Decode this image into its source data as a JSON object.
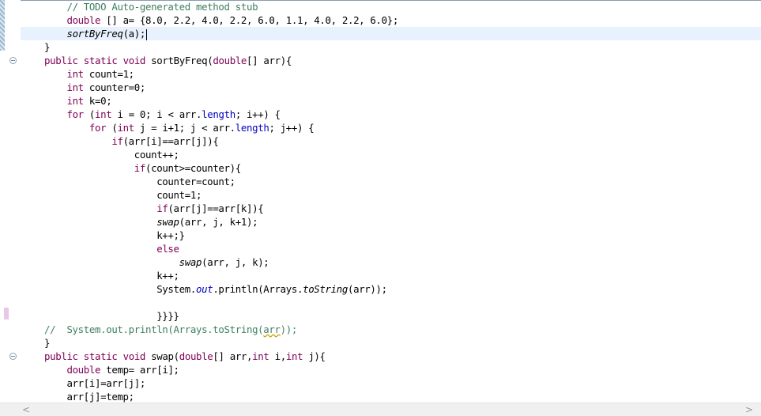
{
  "lines": [
    {
      "segs": [
        {
          "t": "    "
        },
        {
          "t": "// TODO Auto-generated method stub",
          "c": "cm"
        }
      ]
    },
    {
      "segs": [
        {
          "t": "    "
        },
        {
          "t": "double",
          "c": "kw"
        },
        {
          "t": " [] a= {8.0, 2.2, 4.0, 2.2, 6.0, 1.1, 4.0, 2.2, 6.0};"
        }
      ]
    },
    {
      "current": true,
      "cursor": true,
      "segs": [
        {
          "t": "    "
        },
        {
          "t": "sortByFreq",
          "c": "it"
        },
        {
          "t": "(a);"
        }
      ]
    },
    {
      "segs": [
        {
          "t": "}"
        }
      ]
    },
    {
      "fold": true,
      "segs": [
        {
          "t": "public",
          "c": "kw"
        },
        {
          "t": " "
        },
        {
          "t": "static",
          "c": "kw"
        },
        {
          "t": " "
        },
        {
          "t": "void",
          "c": "kw"
        },
        {
          "t": " sortByFreq("
        },
        {
          "t": "double",
          "c": "kw"
        },
        {
          "t": "[] arr){"
        }
      ]
    },
    {
      "segs": [
        {
          "t": "    "
        },
        {
          "t": "int",
          "c": "kw"
        },
        {
          "t": " count=1;"
        }
      ]
    },
    {
      "segs": [
        {
          "t": "    "
        },
        {
          "t": "int",
          "c": "kw"
        },
        {
          "t": " counter=0;"
        }
      ]
    },
    {
      "segs": [
        {
          "t": "    "
        },
        {
          "t": "int",
          "c": "kw"
        },
        {
          "t": " k=0;"
        }
      ]
    },
    {
      "segs": [
        {
          "t": "    "
        },
        {
          "t": "for",
          "c": "kw"
        },
        {
          "t": " ("
        },
        {
          "t": "int",
          "c": "kw"
        },
        {
          "t": " i = 0; i < arr."
        },
        {
          "t": "length",
          "c": "fld"
        },
        {
          "t": "; i++) {"
        }
      ]
    },
    {
      "segs": [
        {
          "t": "        "
        },
        {
          "t": "for",
          "c": "kw"
        },
        {
          "t": " ("
        },
        {
          "t": "int",
          "c": "kw"
        },
        {
          "t": " j = i+1; j < arr."
        },
        {
          "t": "length",
          "c": "fld"
        },
        {
          "t": "; j++) {"
        }
      ]
    },
    {
      "segs": [
        {
          "t": "            "
        },
        {
          "t": "if",
          "c": "kw"
        },
        {
          "t": "(arr[i]==arr[j]){"
        }
      ]
    },
    {
      "segs": [
        {
          "t": "                count++;"
        }
      ]
    },
    {
      "segs": [
        {
          "t": "                "
        },
        {
          "t": "if",
          "c": "kw"
        },
        {
          "t": "(count>=counter){"
        }
      ]
    },
    {
      "segs": [
        {
          "t": "                    counter=count;"
        }
      ]
    },
    {
      "segs": [
        {
          "t": "                    count=1;"
        }
      ]
    },
    {
      "segs": [
        {
          "t": "                    "
        },
        {
          "t": "if",
          "c": "kw"
        },
        {
          "t": "(arr[j]==arr[k]){"
        }
      ]
    },
    {
      "segs": [
        {
          "t": "                    "
        },
        {
          "t": "swap",
          "c": "it"
        },
        {
          "t": "(arr, j, k+1);"
        }
      ]
    },
    {
      "segs": [
        {
          "t": "                    k++;}"
        }
      ]
    },
    {
      "segs": [
        {
          "t": "                    "
        },
        {
          "t": "else",
          "c": "kw"
        }
      ]
    },
    {
      "segs": [
        {
          "t": "                        "
        },
        {
          "t": "swap",
          "c": "it"
        },
        {
          "t": "(arr, j, k);"
        }
      ]
    },
    {
      "segs": [
        {
          "t": "                    k++;"
        }
      ]
    },
    {
      "segs": [
        {
          "t": "                    System."
        },
        {
          "t": "out",
          "c": "fld it"
        },
        {
          "t": ".println(Arrays."
        },
        {
          "t": "toString",
          "c": "it"
        },
        {
          "t": "(arr));"
        }
      ]
    },
    {
      "segs": [
        {
          "t": ""
        }
      ]
    },
    {
      "segs": [
        {
          "t": "                    }}}}"
        }
      ]
    },
    {
      "segs": [
        {
          "t": "//  System.out.println(Arrays.toString(",
          "c": "cm"
        },
        {
          "t": "arr",
          "c": "cm squig"
        },
        {
          "t": "));",
          "c": "cm"
        }
      ]
    },
    {
      "segs": [
        {
          "t": "}"
        }
      ]
    },
    {
      "fold": true,
      "segs": [
        {
          "t": "public",
          "c": "kw"
        },
        {
          "t": " "
        },
        {
          "t": "static",
          "c": "kw"
        },
        {
          "t": " "
        },
        {
          "t": "void",
          "c": "kw"
        },
        {
          "t": " swap("
        },
        {
          "t": "double",
          "c": "kw"
        },
        {
          "t": "[] arr,"
        },
        {
          "t": "int",
          "c": "kw"
        },
        {
          "t": " i,"
        },
        {
          "t": "int",
          "c": "kw"
        },
        {
          "t": " j){"
        }
      ]
    },
    {
      "segs": [
        {
          "t": "    "
        },
        {
          "t": "double",
          "c": "kw"
        },
        {
          "t": " temp= arr[i];"
        }
      ]
    },
    {
      "segs": [
        {
          "t": "    arr[i]=arr[j];"
        }
      ]
    },
    {
      "segs": [
        {
          "t": "    arr[j]=temp;"
        }
      ]
    }
  ],
  "scrollbar": {
    "left_arrow": "<",
    "right_arrow": ">"
  },
  "colors": {
    "keyword": "#7f0055",
    "comment": "#3f7f5f",
    "field": "#0000c0",
    "current_line": "#e8f2fe"
  }
}
